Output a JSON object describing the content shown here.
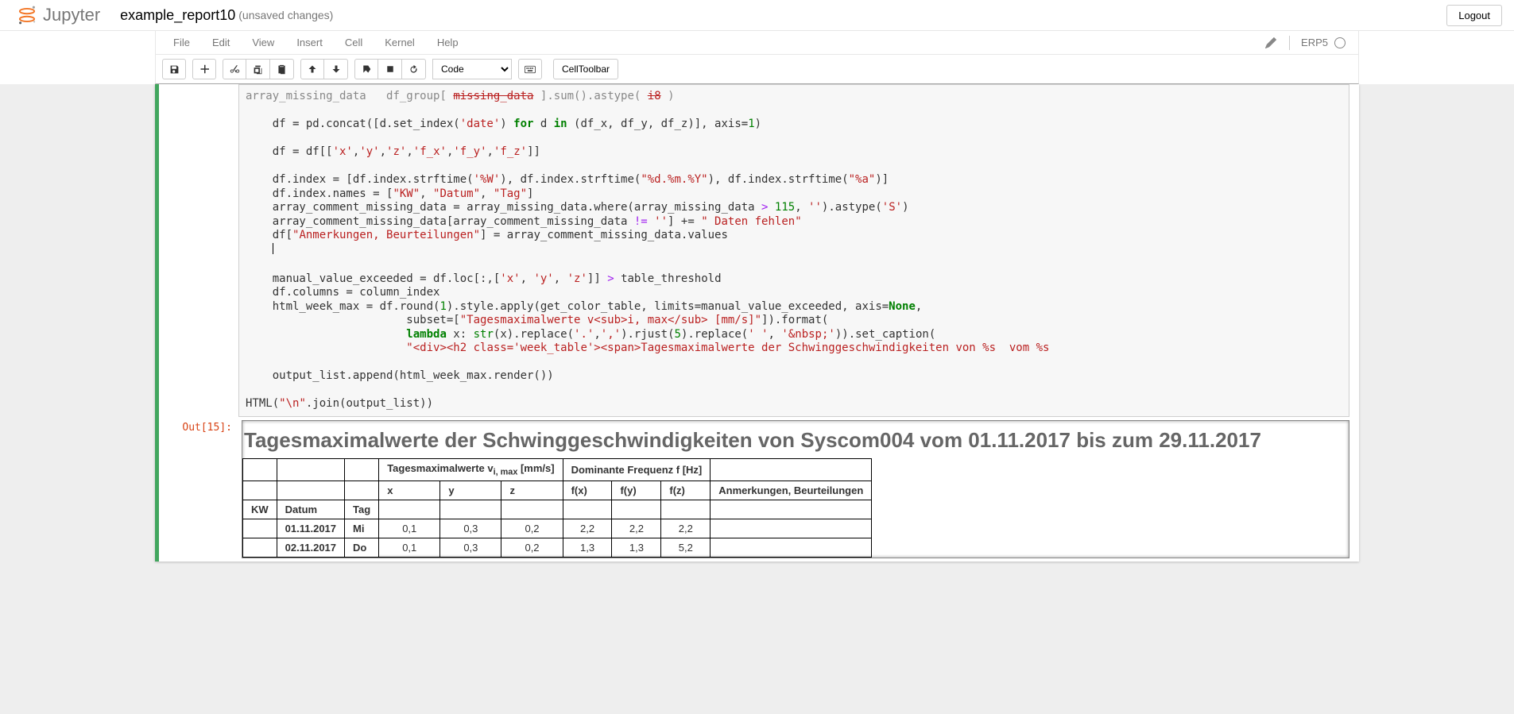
{
  "header": {
    "logo_text": "Jupyter",
    "notebook_name": "example_report10",
    "save_status": "(unsaved changes)",
    "logout_label": "Logout"
  },
  "menubar": {
    "items": [
      "File",
      "Edit",
      "View",
      "Insert",
      "Cell",
      "Kernel",
      "Help"
    ],
    "kernel_name": "ERP5"
  },
  "toolbar": {
    "cell_type_selected": "Code",
    "cell_toolbar_label": "CellToolbar"
  },
  "cell": {
    "out_prompt": "Out[15]:"
  },
  "output_table": {
    "caption": "Tagesmaximalwerte der Schwinggeschwindigkeiten von Syscom004 vom 01.11.2017 bis zum 29.11.2017",
    "group_headers": {
      "g1": "Tagesmaximalwerte v",
      "g1_sub": "i, max",
      "g1_unit": " [mm/s]",
      "g2": "Dominante Frequenz f [Hz]"
    },
    "col_headers": {
      "kw": "KW",
      "datum": "Datum",
      "tag": "Tag",
      "x": "x",
      "y": "y",
      "z": "z",
      "fx": "f(x)",
      "fy": "f(y)",
      "fz": "f(z)",
      "anm": "Anmerkungen, Beurteilungen"
    },
    "rows": [
      {
        "kw": "",
        "datum": "01.11.2017",
        "tag": "Mi",
        "x": "0,1",
        "y": "0,3",
        "z": "0,2",
        "fx": "2,2",
        "fy": "2,2",
        "fz": "2,2",
        "anm": ""
      },
      {
        "kw": "",
        "datum": "02.11.2017",
        "tag": "Do",
        "x": "0,1",
        "y": "0,3",
        "z": "0,2",
        "fx": "1,3",
        "fy": "1,3",
        "fz": "5,2",
        "anm": ""
      }
    ]
  }
}
